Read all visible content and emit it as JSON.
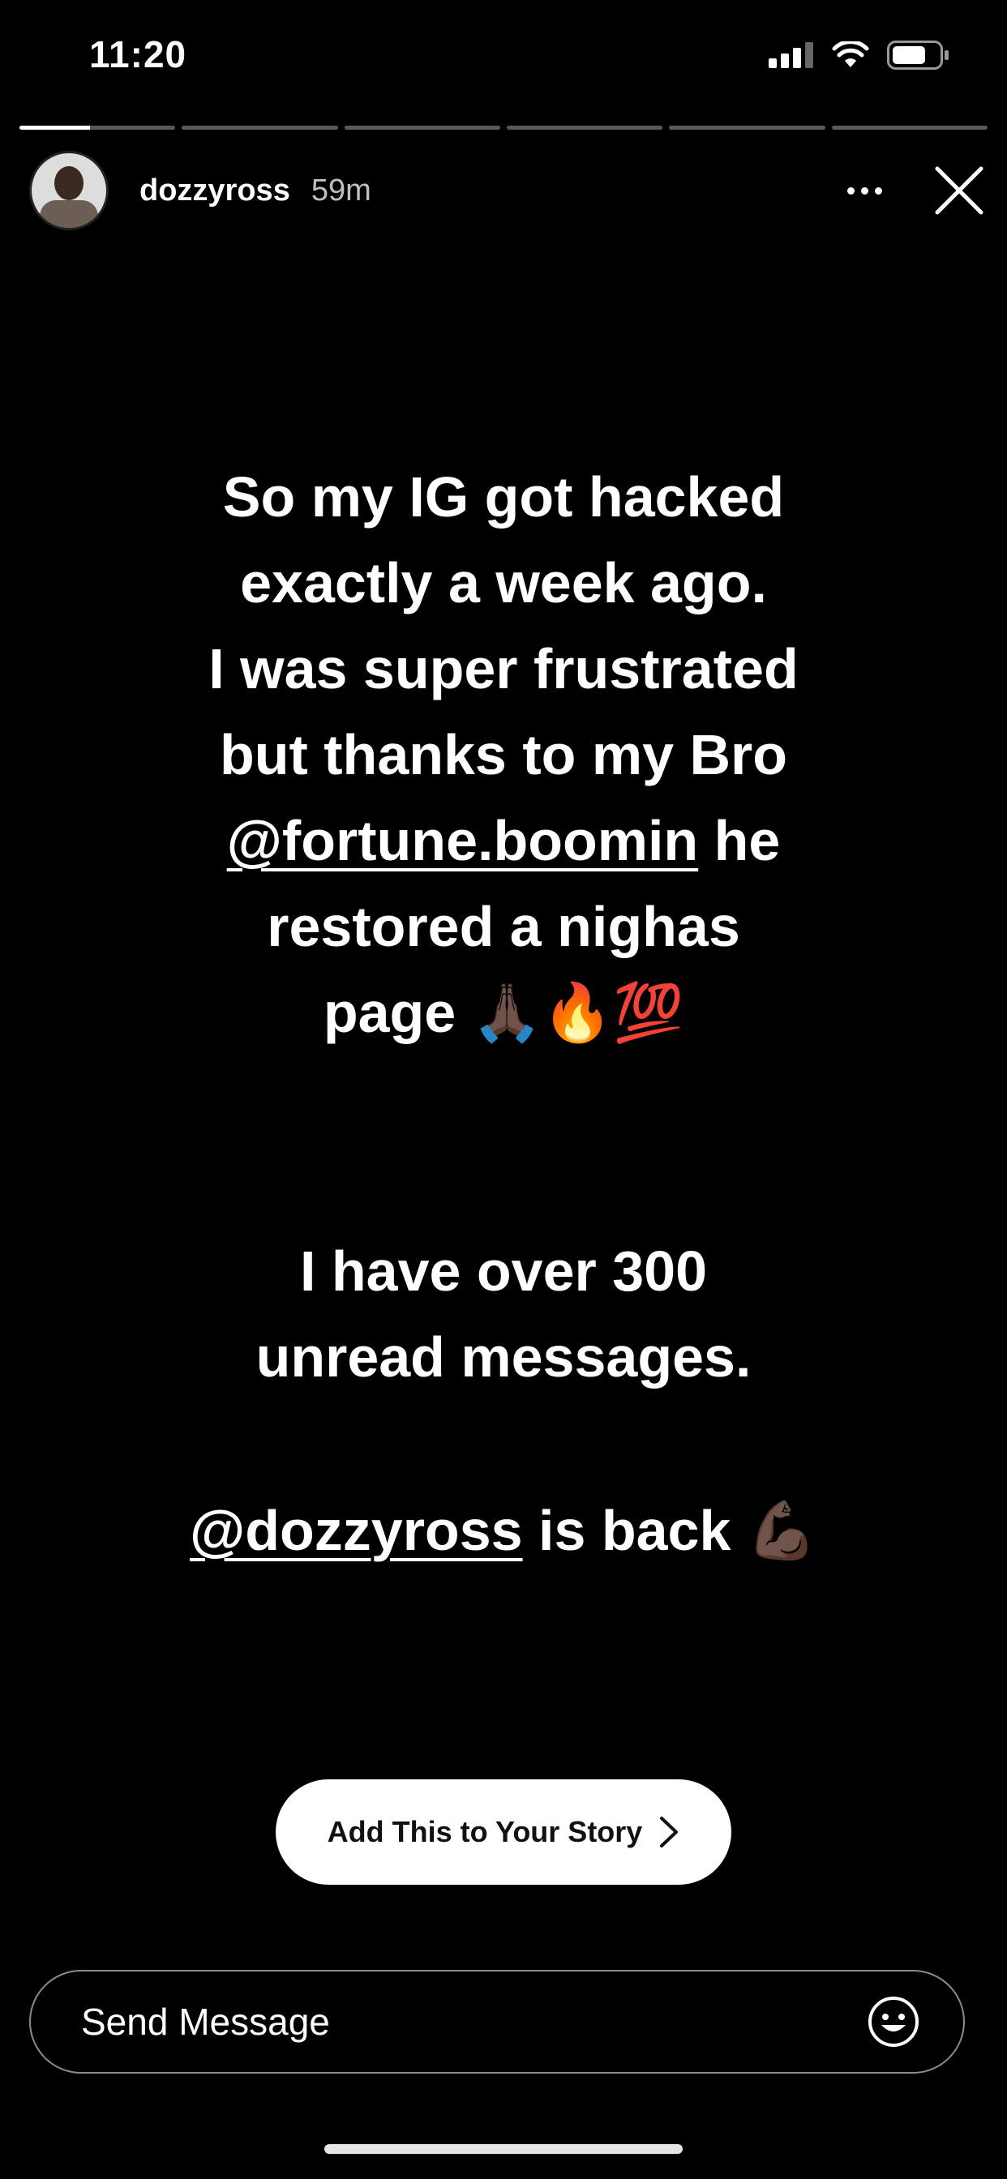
{
  "status_bar": {
    "time": "11:20"
  },
  "story": {
    "segments_total": 6,
    "current_segment": 1,
    "current_progress_fraction": 0.45
  },
  "header": {
    "username": "dozzyross",
    "time_ago": "59m"
  },
  "text": {
    "line1": "So my IG got hacked",
    "line2": "exactly a week ago.",
    "line3": "I was super frustrated",
    "line4": "but thanks to my Bro",
    "line5_mention": "@fortune.boomin",
    "line5_rest": " he",
    "line6": "restored a nighas",
    "line7": "page 🙏🏿🔥💯",
    "line8": "I have over 300",
    "line9": "unread messages.",
    "line10_mention": "@dozzyross",
    "line10_rest": " is back 💪🏿"
  },
  "cta": {
    "label": "Add This to Your Story"
  },
  "composer": {
    "placeholder": "Send Message"
  },
  "colors": {
    "background": "#000000",
    "text": "#ffffff",
    "button_bg": "#ffffff"
  }
}
